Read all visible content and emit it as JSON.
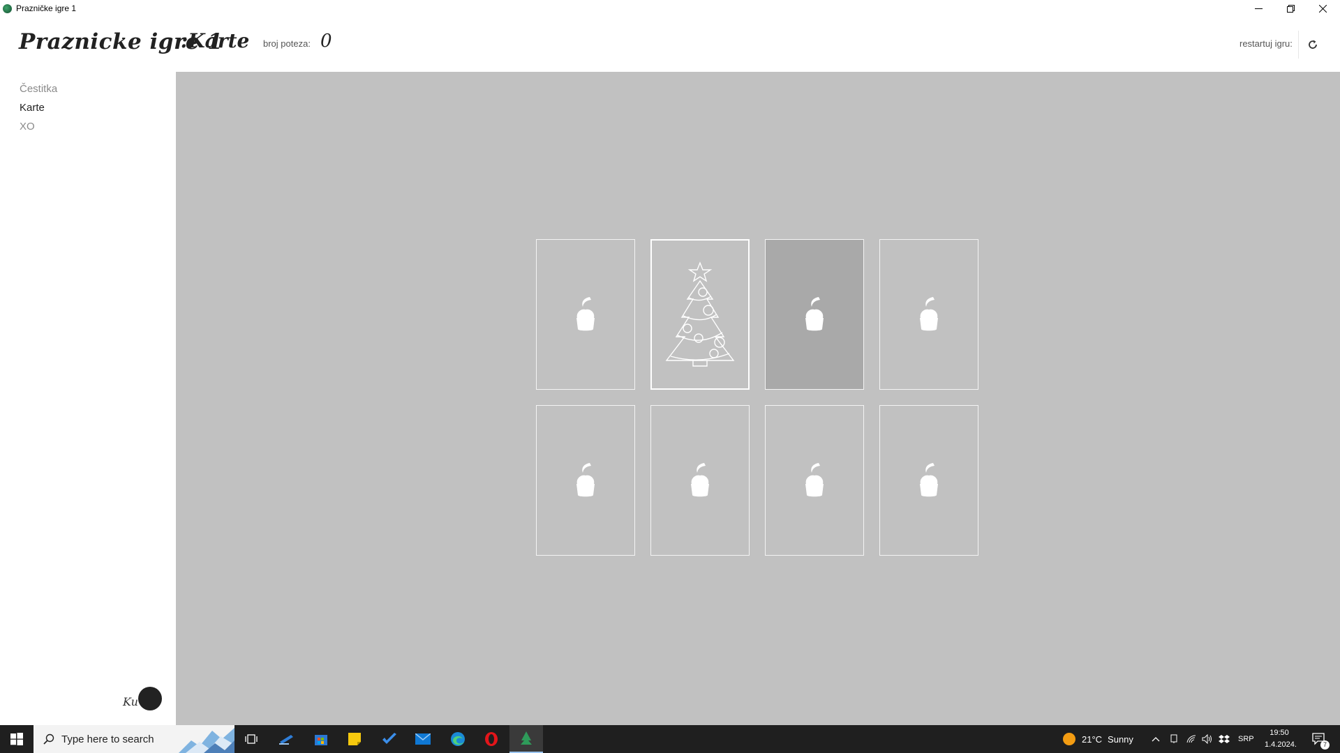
{
  "window": {
    "title": "Prazničke igre 1"
  },
  "header": {
    "app_title": "Praznicke igre 1",
    "game_title": ":Karte",
    "moves_label": "broj poteza:",
    "moves_value": "0",
    "restart_label": "restartuj igru:",
    "restart_icon": "refresh-icon"
  },
  "sidebar": {
    "items": [
      {
        "label": "Čestitka",
        "active": false
      },
      {
        "label": "Karte",
        "active": true
      },
      {
        "label": "XO",
        "active": false
      }
    ],
    "signature_text": "Ku"
  },
  "board": {
    "rows": 2,
    "cols": 4,
    "cards": [
      {
        "face": "back",
        "icon": "cupcake-icon"
      },
      {
        "face": "front",
        "icon": "christmas-tree-icon"
      },
      {
        "face": "back",
        "icon": "cupcake-icon",
        "hovered": true
      },
      {
        "face": "back",
        "icon": "cupcake-icon"
      },
      {
        "face": "back",
        "icon": "cupcake-icon"
      },
      {
        "face": "back",
        "icon": "cupcake-icon"
      },
      {
        "face": "back",
        "icon": "cupcake-icon"
      },
      {
        "face": "back",
        "icon": "cupcake-icon"
      }
    ]
  },
  "taskbar": {
    "search_placeholder": "Type here to search",
    "weather": {
      "temp": "21°C",
      "condition": "Sunny"
    },
    "language": "SRP",
    "time": "19:50",
    "date": "1.4.2024.",
    "notifications": "7"
  },
  "colors": {
    "board_bg": "#c1c1c1",
    "card_hover": "#a9a9a9",
    "taskbar_bg": "#1f1f1f"
  }
}
